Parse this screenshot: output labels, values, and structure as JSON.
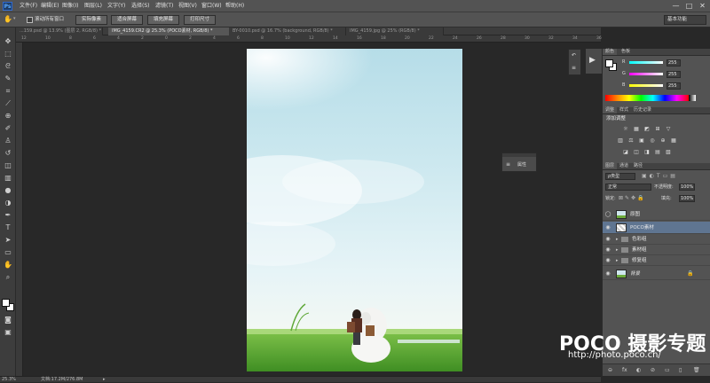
{
  "menubar": {
    "logo": "Ps",
    "items": [
      "文件(F)",
      "编辑(E)",
      "图像(I)",
      "图层(L)",
      "文字(Y)",
      "选择(S)",
      "滤镜(T)",
      "视图(V)",
      "窗口(W)",
      "帮助(H)"
    ],
    "window_controls": [
      "—",
      "□",
      "✕"
    ]
  },
  "options": {
    "scroll_all_windows": "滚动所有窗口",
    "actual_pixels": "实际像素",
    "fit_screen": "适合屏幕",
    "fill_screen": "填充屏幕",
    "print_size": "打印尺寸",
    "workspace": "基本功能"
  },
  "tabs": [
    {
      "label": "...159.psd @ 13.9% (图层 2, RGB/8) *",
      "active": false
    },
    {
      "label": "IMG_4159.CR2 @ 25.3% (POCO素材, RGB/8) *",
      "active": true
    },
    {
      "label": "BY-0010.psd @ 16.7% (background, RGB/8) *",
      "active": false
    },
    {
      "label": "IMG_4159.jpg @ 25% (RGB/8) *",
      "active": false
    }
  ],
  "ruler_top": [
    "12",
    "10",
    "8",
    "6",
    "4",
    "2",
    "0",
    "2",
    "4",
    "6",
    "8",
    "10",
    "12",
    "14",
    "16",
    "18",
    "20",
    "22",
    "24",
    "26",
    "28",
    "30",
    "32",
    "34",
    "36"
  ],
  "status": {
    "zoom": "25.3%",
    "doc": "文档:17.2M/276.8M"
  },
  "properties_float": {
    "label": "属性"
  },
  "color_panel": {
    "tabs": [
      "颜色",
      "色板"
    ],
    "channels": [
      {
        "name": "R",
        "value": "255",
        "color": "#ff4040"
      },
      {
        "name": "G",
        "value": "255",
        "color": "#40ff60"
      },
      {
        "name": "B",
        "value": "255",
        "color": "#4060ff"
      }
    ]
  },
  "adjustments_panel": {
    "tabs": [
      "调整",
      "样式",
      "历史记录"
    ],
    "title": "添加调整",
    "icons_row1": [
      "☼",
      "▦",
      "◩",
      "⊞",
      "▽"
    ],
    "icons_row2": [
      "▥",
      "⚖",
      "▣",
      "◎",
      "⊕",
      "▦"
    ],
    "icons_row3": [
      "◪",
      "◫",
      "◨",
      "▤",
      "▧"
    ]
  },
  "layers_panel": {
    "tabs": [
      "图层",
      "通道",
      "路径"
    ],
    "filter": "ρ类型",
    "blend_mode": "正常",
    "opacity_label": "不透明度:",
    "opacity_value": "100%",
    "lock_label": "锁定:",
    "fill_label": "填充:",
    "fill_value": "100%",
    "layers": [
      {
        "name": "原图",
        "type": "image",
        "selected": false
      },
      {
        "name": "POCO素材",
        "type": "image",
        "selected": true
      },
      {
        "name": "色彩组",
        "type": "group",
        "selected": false
      },
      {
        "name": "素材组",
        "type": "group",
        "selected": false
      },
      {
        "name": "修复组",
        "type": "group",
        "selected": false
      },
      {
        "name": "背景",
        "type": "background",
        "selected": false
      }
    ],
    "footer_icons": [
      "⊖",
      "fx",
      "◐",
      "⊘",
      "▭",
      "▯",
      "🗑"
    ]
  },
  "watermark": {
    "line1": "POCO 摄影专题",
    "line2": "http://photo.poco.cn/"
  }
}
